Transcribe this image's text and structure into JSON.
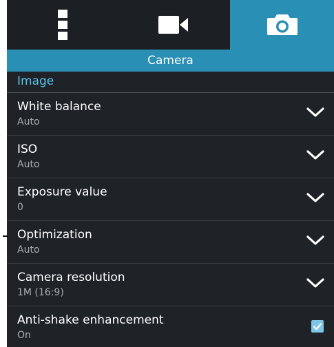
{
  "tabs": [
    {
      "icon": "more-icon"
    },
    {
      "icon": "video-camera-icon"
    },
    {
      "icon": "camera-icon",
      "selected": true
    }
  ],
  "header": {
    "title": "Camera"
  },
  "section": {
    "title": "Image"
  },
  "settings": [
    {
      "title": "White balance",
      "value": "Auto",
      "control": "dropdown"
    },
    {
      "title": "ISO",
      "value": "Auto",
      "control": "dropdown"
    },
    {
      "title": "Exposure value",
      "value": "0",
      "control": "dropdown"
    },
    {
      "title": "Optimization",
      "value": "Auto",
      "control": "dropdown"
    },
    {
      "title": "Camera resolution",
      "value": "1M (16:9)",
      "control": "dropdown"
    },
    {
      "title": "Anti-shake enhancement",
      "value": "On",
      "control": "checkbox",
      "checked": true
    }
  ],
  "colors": {
    "accent": "#2a8fb5",
    "section_title": "#57c3ea",
    "background": "#1f2226",
    "checkbox": "#7fc6e6"
  }
}
